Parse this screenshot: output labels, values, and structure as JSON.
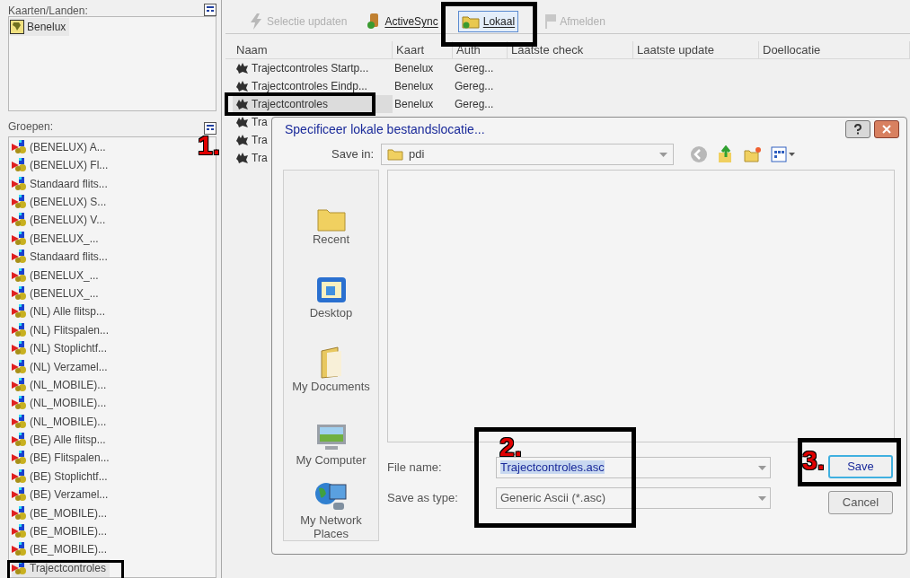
{
  "maps_panel": {
    "label": "Kaarten/Landen:",
    "items": [
      {
        "label": "Benelux",
        "selected": true
      }
    ]
  },
  "groups_panel": {
    "label": "Groepen:",
    "items": [
      {
        "label": "(BENELUX) A...",
        "selected": false
      },
      {
        "label": "(BENELUX) Fl...",
        "selected": false
      },
      {
        "label": "Standaard flits...",
        "selected": false
      },
      {
        "label": "(BENELUX) S...",
        "selected": false
      },
      {
        "label": "(BENELUX) V...",
        "selected": false
      },
      {
        "label": "(BENELUX_...",
        "selected": false
      },
      {
        "label": "Standaard flits...",
        "selected": false
      },
      {
        "label": "(BENELUX_...",
        "selected": false
      },
      {
        "label": "(BENELUX_...",
        "selected": false
      },
      {
        "label": "(NL) Alle flitsp...",
        "selected": false
      },
      {
        "label": "(NL) Flitspalen...",
        "selected": false
      },
      {
        "label": "(NL) Stoplichtf...",
        "selected": false
      },
      {
        "label": "(NL) Verzamel...",
        "selected": false
      },
      {
        "label": "(NL_MOBILE)...",
        "selected": false
      },
      {
        "label": "(NL_MOBILE)...",
        "selected": false
      },
      {
        "label": "(NL_MOBILE)...",
        "selected": false
      },
      {
        "label": "(BE) Alle flitsp...",
        "selected": false
      },
      {
        "label": "(BE) Flitspalen...",
        "selected": false
      },
      {
        "label": "(BE) Stoplichtf...",
        "selected": false
      },
      {
        "label": "(BE) Verzamel...",
        "selected": false
      },
      {
        "label": "(BE_MOBILE)...",
        "selected": false
      },
      {
        "label": "(BE_MOBILE)...",
        "selected": false
      },
      {
        "label": "(BE_MOBILE)...",
        "selected": false
      },
      {
        "label": "Trajectcontroles",
        "selected": true
      }
    ]
  },
  "toolbar": [
    {
      "label": "Selectie updaten",
      "disabled": true,
      "selected": false
    },
    {
      "label": "ActiveSync",
      "disabled": false,
      "selected": false
    },
    {
      "label": "Lokaal",
      "disabled": false,
      "selected": true
    },
    {
      "label": "Afmelden",
      "disabled": true,
      "selected": false
    }
  ],
  "table": {
    "columns": [
      "Naam",
      "Kaart",
      "Auth",
      "Laatste check",
      "Laatste update",
      "Doellocatie"
    ],
    "rows": [
      {
        "cells": [
          "Trajectcontroles Startp...",
          "Benelux",
          "Gereg..."
        ],
        "selected": false
      },
      {
        "cells": [
          "Trajectcontroles Eindp...",
          "Benelux",
          "Gereg..."
        ],
        "selected": false
      },
      {
        "cells": [
          "Trajectcontroles",
          "Benelux",
          "Gereg..."
        ],
        "selected": true
      },
      {
        "cells": [
          "Tra"
        ],
        "selected": false
      },
      {
        "cells": [
          "Tra"
        ],
        "selected": false
      },
      {
        "cells": [
          "Tra"
        ],
        "selected": false
      }
    ]
  },
  "dialog": {
    "title": "Specificeer lokale bestandslocatie...",
    "save_in": {
      "label": "Save in:",
      "value": "pdi"
    },
    "places": [
      "Recent",
      "Desktop",
      "My Documents",
      "My Computer",
      "My Network Places"
    ],
    "file_name": {
      "label": "File name:",
      "value": "Trajectcontroles.asc"
    },
    "save_as_type": {
      "label": "Save as type:",
      "value": "Generic Ascii (*.asc)"
    },
    "buttons": [
      {
        "label": "Save",
        "default": true
      },
      {
        "label": "Cancel",
        "default": false
      }
    ]
  },
  "annotations": [
    "1.",
    "2.",
    "3."
  ]
}
